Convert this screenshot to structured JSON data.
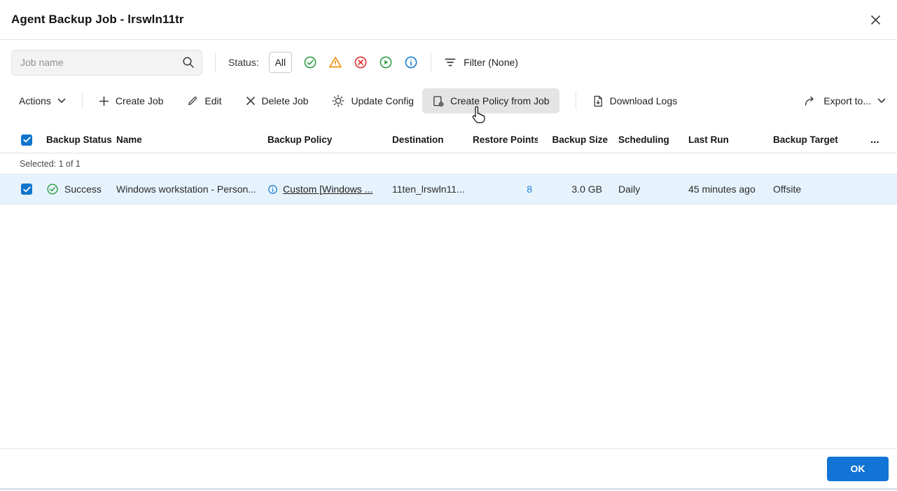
{
  "dialog": {
    "title": "Agent Backup Job - lrswln11tr",
    "ok": "OK"
  },
  "filters": {
    "search_placeholder": "Job name",
    "status_label": "Status:",
    "all": "All",
    "status_filter_icons": [
      "success-icon",
      "warning-icon",
      "error-icon",
      "running-icon",
      "info-icon"
    ],
    "filter": "Filter (None)"
  },
  "toolbar": {
    "actions": "Actions",
    "create_job": "Create Job",
    "edit": "Edit",
    "delete_job": "Delete Job",
    "update_config": "Update Config",
    "create_policy_from_job": "Create Policy from Job",
    "download_logs": "Download Logs",
    "export_to": "Export to..."
  },
  "table": {
    "headers": [
      "Backup Status",
      "Name",
      "Backup Policy",
      "Destination",
      "Restore Points",
      "Backup Size",
      "Scheduling",
      "Last Run",
      "Backup Target"
    ],
    "more": "...",
    "selected": "Selected: 1 of 1",
    "rows": [
      {
        "status": "Success",
        "name": "Windows workstation - Person...",
        "backup_policy": "Custom [Windows ...",
        "destination": "11ten_lrswln11...",
        "restore_points": "8",
        "backup_size": "3.0 GB",
        "scheduling": "Daily",
        "last_run": "45 minutes ago",
        "backup_target": "Offsite"
      }
    ]
  },
  "colors": {
    "accent": "#1274d4",
    "selected_row": "#e7f3fc",
    "success": "#2f9e44",
    "warning": "#f08c00",
    "error": "#e03131",
    "running": "#2f9e44",
    "info": "#1c7ed6",
    "link": "#1c7ed6"
  }
}
